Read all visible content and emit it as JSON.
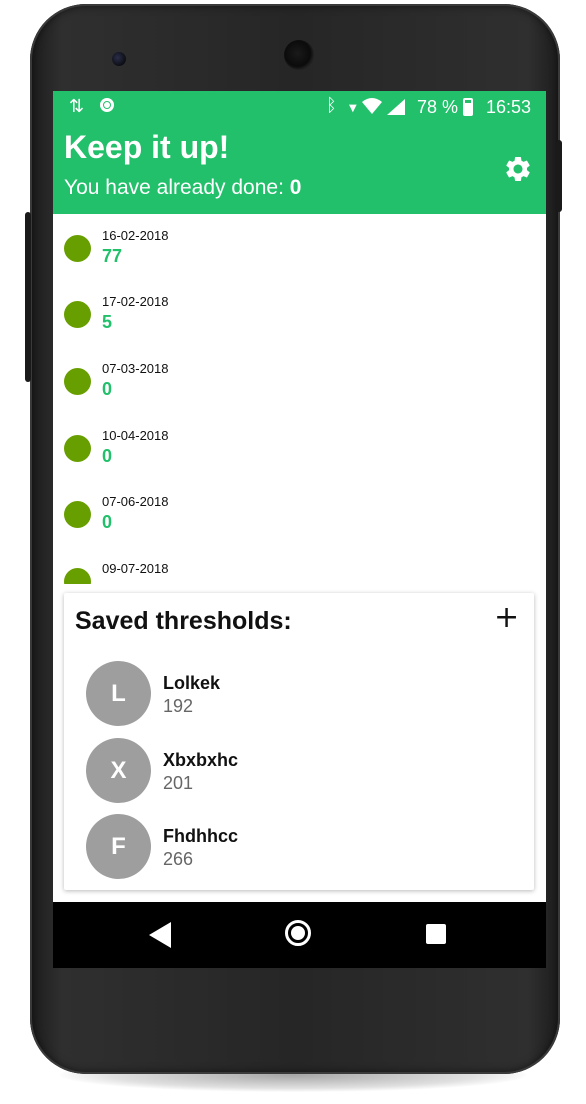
{
  "status_bar": {
    "battery": "78 %",
    "time": "16:53",
    "icons": [
      "data-transfer-icon",
      "sync-circle-icon",
      "bluetooth-icon",
      "wifi-icon",
      "signal-icon",
      "battery-charging-icon"
    ]
  },
  "header": {
    "title": "Keep it up!",
    "subtitle_prefix": "You have already done: ",
    "subtitle_count": "0",
    "settings_icon": "gear-icon"
  },
  "history": [
    {
      "date": "16-02-2018",
      "value": "77"
    },
    {
      "date": "17-02-2018",
      "value": "5"
    },
    {
      "date": "07-03-2018",
      "value": "0"
    },
    {
      "date": "10-04-2018",
      "value": "0"
    },
    {
      "date": "07-06-2018",
      "value": "0"
    },
    {
      "date": "09-07-2018",
      "value": ""
    }
  ],
  "thresholds_card": {
    "title": "Saved thresholds:",
    "add_label": "+",
    "items": [
      {
        "initial": "L",
        "name": "Lolkek",
        "value": "192"
      },
      {
        "initial": "X",
        "name": "Xbxbxhc",
        "value": "201"
      },
      {
        "initial": "F",
        "name": "Fhdhhcc",
        "value": "266"
      }
    ]
  },
  "colors": {
    "primary": "#22c06b",
    "dot": "#689f00",
    "avatar": "#9e9e9e"
  }
}
